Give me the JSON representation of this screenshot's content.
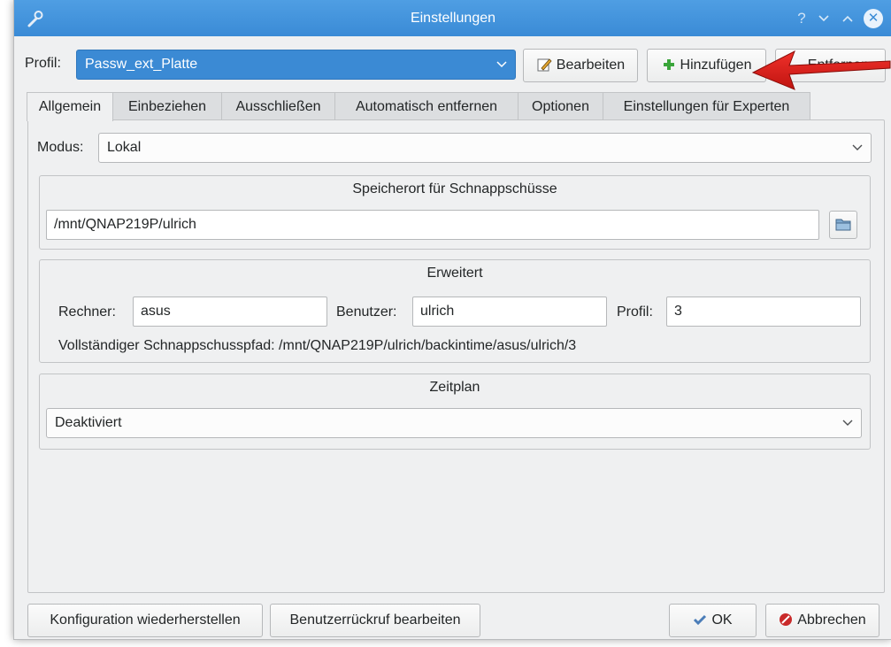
{
  "window": {
    "title": "Einstellungen",
    "help_icon": "?",
    "minimize_icon": "⌄",
    "maximize_icon": "⌃",
    "close_icon": "✕",
    "accent_color": "#3b8ad4"
  },
  "profile": {
    "label": "Profil:",
    "selected": "Passw_ext_Platte",
    "edit_label": "Bearbeiten",
    "add_label": "Hinzufügen",
    "remove_label": "Entfernen"
  },
  "tabs": [
    {
      "label": "Allgemein",
      "active": true
    },
    {
      "label": "Einbeziehen",
      "active": false
    },
    {
      "label": "Ausschließen",
      "active": false
    },
    {
      "label": "Automatisch entfernen",
      "active": false
    },
    {
      "label": "Optionen",
      "active": false
    },
    {
      "label": "Einstellungen für Experten",
      "active": false
    }
  ],
  "general": {
    "mode_label": "Modus:",
    "mode_value": "Lokal",
    "snapshot_location": {
      "title": "Speicherort für Schnappschüsse",
      "path": "/mnt/QNAP219P/ulrich"
    },
    "advanced": {
      "title": "Erweitert",
      "host_label": "Rechner:",
      "host_value": "asus",
      "user_label": "Benutzer:",
      "user_value": "ulrich",
      "profile_label": "Profil:",
      "profile_value": "3",
      "full_path": "Vollständiger Schnappschusspfad: /mnt/QNAP219P/ulrich/backintime/asus/ulrich/3"
    },
    "schedule": {
      "title": "Zeitplan",
      "value": "Deaktiviert"
    }
  },
  "footer": {
    "restore_config_label": "Konfiguration wiederherstellen",
    "user_callback_label": "Benutzerrückruf bearbeiten",
    "ok_label": "OK",
    "cancel_label": "Abbrechen"
  },
  "annotation": {
    "arrow_color": "#e0201c"
  }
}
